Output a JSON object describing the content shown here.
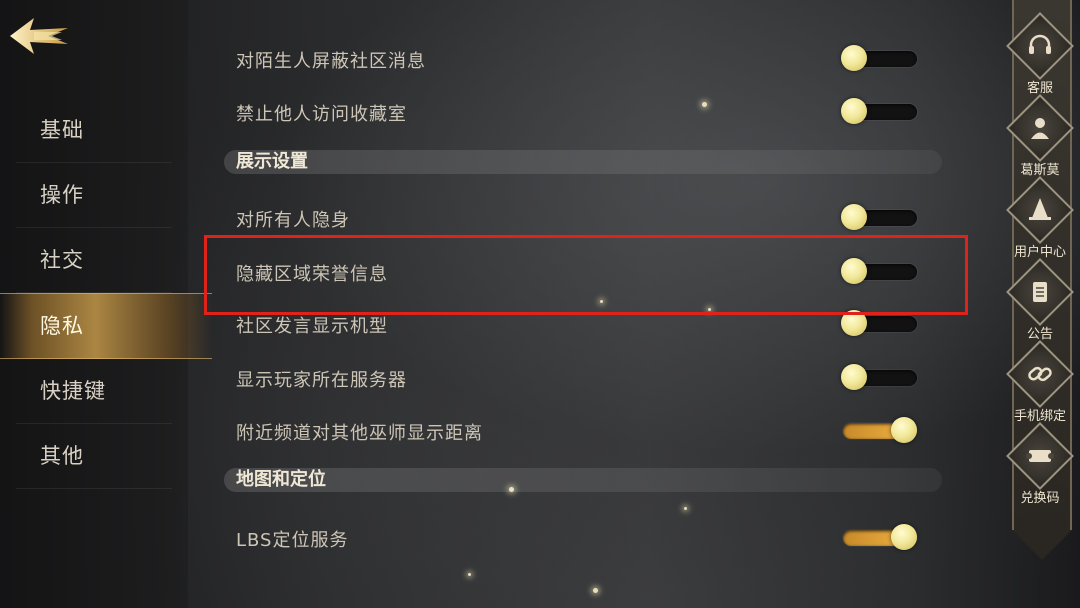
{
  "nav": {
    "back_icon": "back-arrow-icon",
    "items": [
      "基础",
      "操作",
      "社交",
      "隐私",
      "快捷键",
      "其他"
    ],
    "active": "隐私"
  },
  "settings": {
    "rows": [
      {
        "label": "对陌生人屏蔽社区消息",
        "state": "off"
      },
      {
        "label": "禁止他人访问收藏室",
        "state": "off"
      }
    ],
    "section_display": "展示设置",
    "display_rows": [
      {
        "label": "对所有人隐身",
        "state": "off"
      },
      {
        "label": "隐藏区域荣誉信息",
        "state": "off"
      },
      {
        "label": "社区发言显示机型",
        "state": "off"
      },
      {
        "label": "显示玩家所在服务器",
        "state": "off"
      },
      {
        "label": "附近频道对其他巫师显示距离",
        "state": "on"
      }
    ],
    "section_map": "地图和定位",
    "map_rows": [
      {
        "label": "LBS定位服务",
        "state": "on"
      }
    ]
  },
  "sidebar": {
    "items": [
      {
        "label": "客服",
        "icon": "headset-icon"
      },
      {
        "label": "葛斯莫",
        "icon": "character-icon"
      },
      {
        "label": "用户中心",
        "icon": "wizard-hat-icon"
      },
      {
        "label": "公告",
        "icon": "scroll-icon"
      },
      {
        "label": "手机绑定",
        "icon": "chain-link-icon"
      },
      {
        "label": "兑换码",
        "icon": "ticket-icon"
      }
    ]
  },
  "colors": {
    "accent_gold": "#f2b545",
    "highlight_red": "#e0231a",
    "knob": "#f2e89a"
  }
}
